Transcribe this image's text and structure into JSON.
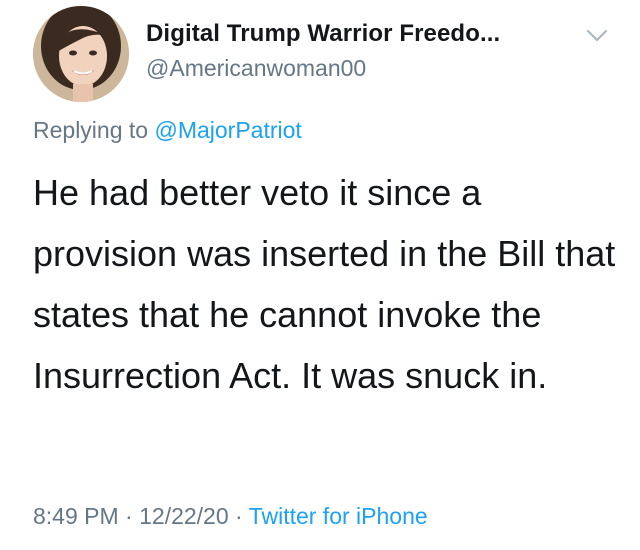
{
  "tweet": {
    "display_name": "Digital Trump Warrior Freedo...",
    "handle": "@Americanwoman00",
    "reply_prefix": "Replying to",
    "reply_to": "@MajorPatriot",
    "text": "He had better veto it since a provision was inserted in the Bill that states that he cannot invoke the Insurrection Act. It was snuck in.",
    "time": "8:49 PM",
    "date": "12/22/20",
    "separator": "·",
    "source": "Twitter for iPhone",
    "avatar_icon": "profile-photo",
    "menu_icon": "chevron-down-icon"
  },
  "colors": {
    "text_primary": "#14171a",
    "text_secondary": "#657786",
    "link": "#1da1f2",
    "background": "#ffffff"
  }
}
